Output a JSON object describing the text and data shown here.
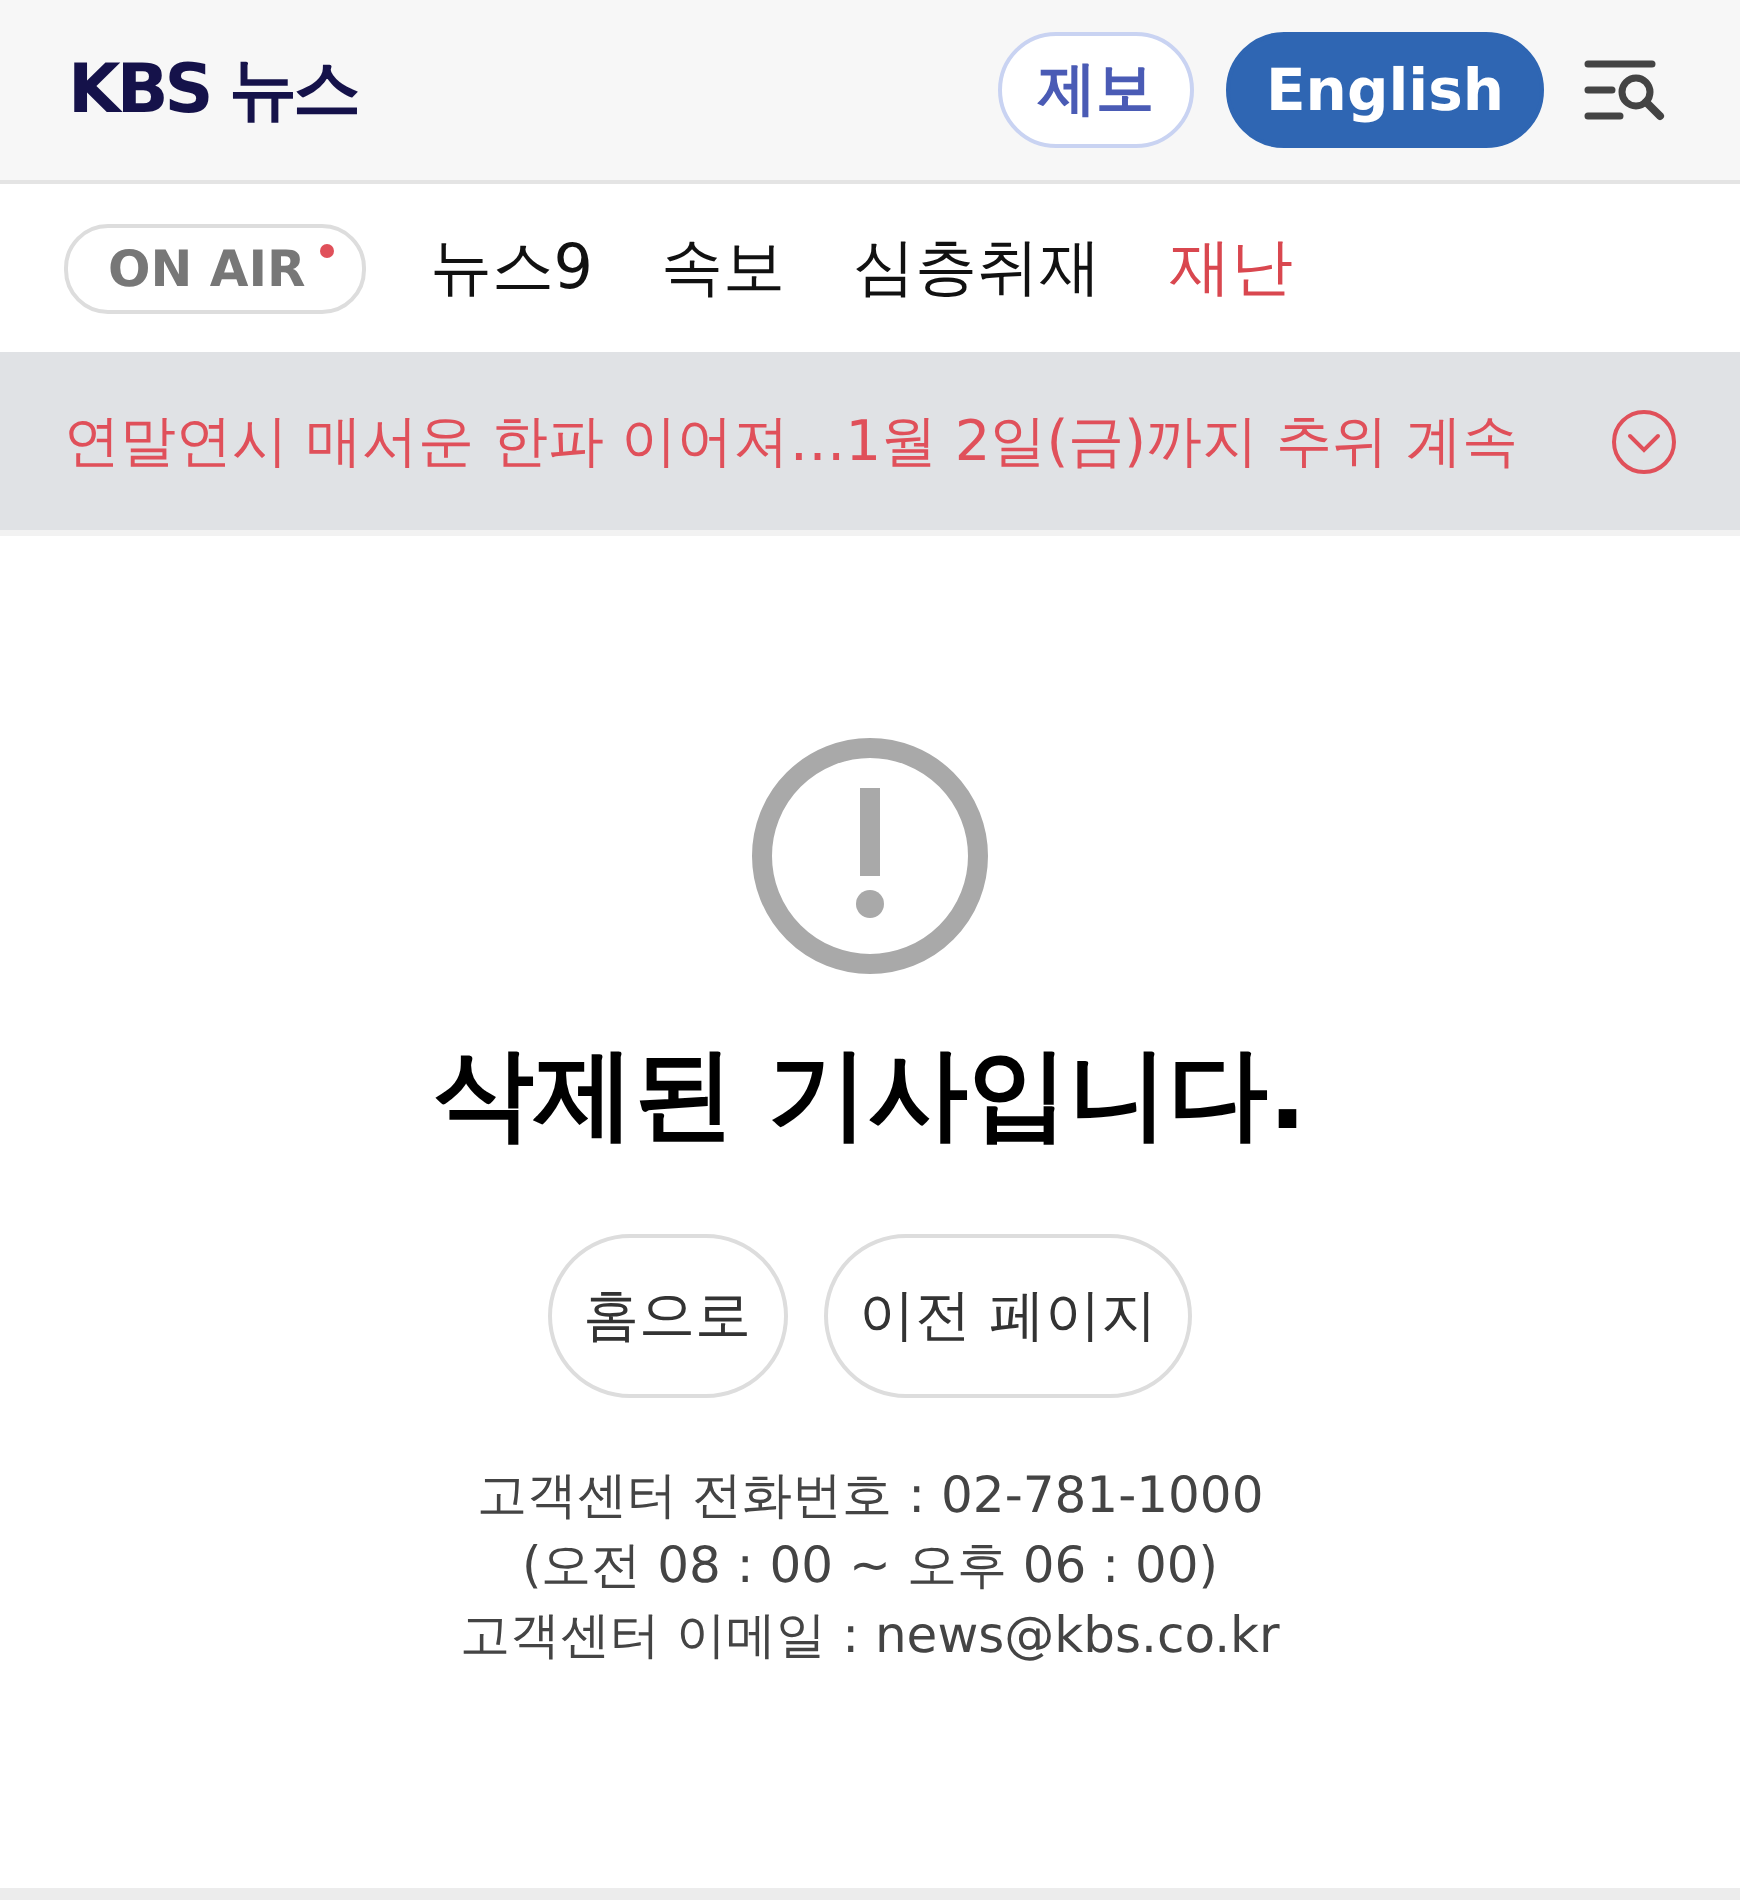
{
  "header": {
    "logo": "KBS 뉴스",
    "buttons": [
      {
        "label": "제보",
        "kind": "outline"
      },
      {
        "label": "English",
        "kind": "filled"
      }
    ]
  },
  "nav": {
    "on_air": {
      "label": "ON AIR",
      "live": true
    },
    "items": [
      {
        "label": "뉴스9",
        "kind": "normal"
      },
      {
        "label": "속보",
        "kind": "normal"
      },
      {
        "label": "심층취재",
        "kind": "normal"
      },
      {
        "label": "재난",
        "kind": "alert"
      }
    ]
  },
  "ticker": {
    "text": "연말연시 매서운 한파 이어져…1월 2일(금)까지 추위 계속",
    "expanded": false
  },
  "error": {
    "title": "삭제된 기사입니다.",
    "buttons": [
      "홈으로",
      "이전 페이지"
    ],
    "contact": [
      "고객센터 전화번호 : 02-781-1000",
      "(오전 08 : 00 ~ 오후 06 : 00)",
      "고객센터 이메일 : news@kbs.co.kr"
    ]
  }
}
